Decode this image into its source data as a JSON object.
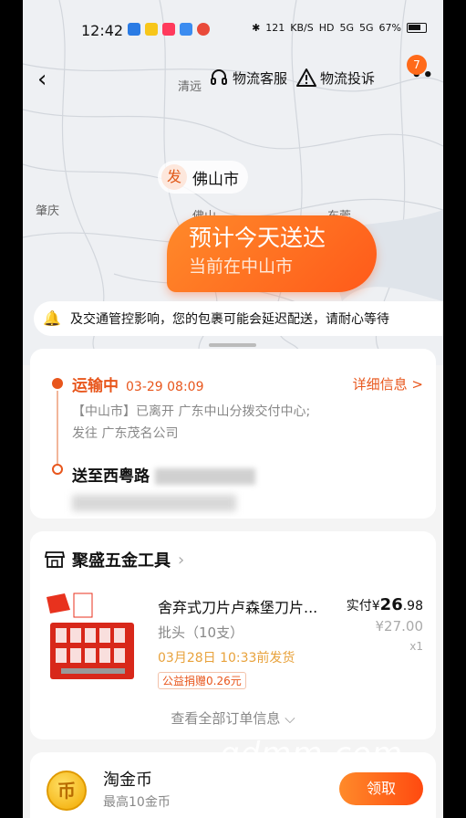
{
  "status_bar": {
    "time": "12:42",
    "network_speed": "121",
    "network_unit": "KB/S",
    "hd": "HD",
    "signal1": "5G",
    "signal2": "5G",
    "battery": "67%"
  },
  "header": {
    "service_label": "物流客服",
    "complaint_label": "物流投诉",
    "badge_count": "7"
  },
  "map": {
    "labels": [
      "清远",
      "肇庆",
      "佛山",
      "东莞"
    ],
    "origin_tag": "发",
    "origin_city": "佛山市",
    "eta_title": "预计今天送达",
    "eta_sub": "当前在中山市"
  },
  "notice": {
    "text": "及交通管控影响，您的包裹可能会延迟配送，请耐心等待"
  },
  "tracking": {
    "status": "运输中",
    "time": "03-29 08:09",
    "detail_link": "详细信息 >",
    "line1": "【中山市】已离开 广东中山分拨交付中心;",
    "line2": "发往 广东茂名公司",
    "dest_prefix": "送至西粤路"
  },
  "order": {
    "shop_name": "聚盛五金工具",
    "product_title": "舍弃式刀片卢森堡刀片...",
    "spec": "批头（10支）",
    "ship_note": "03月28日 10:33前发货",
    "gift_tag": "公益捐赠0.26元",
    "paid_label": "实付",
    "paid_currency": "¥",
    "paid_int": "26",
    "paid_dec": ".98",
    "orig_price": "¥27.00",
    "qty": "x1",
    "view_all": "查看全部订单信息 ⌵"
  },
  "coins": {
    "title": "淘金币",
    "subtitle": "最高10金币",
    "claim": "领取",
    "icon_char": "币"
  },
  "watermark": "gdmm.com",
  "colors": {
    "accent": "#ff6a1a",
    "accent_text": "#e8561c"
  }
}
